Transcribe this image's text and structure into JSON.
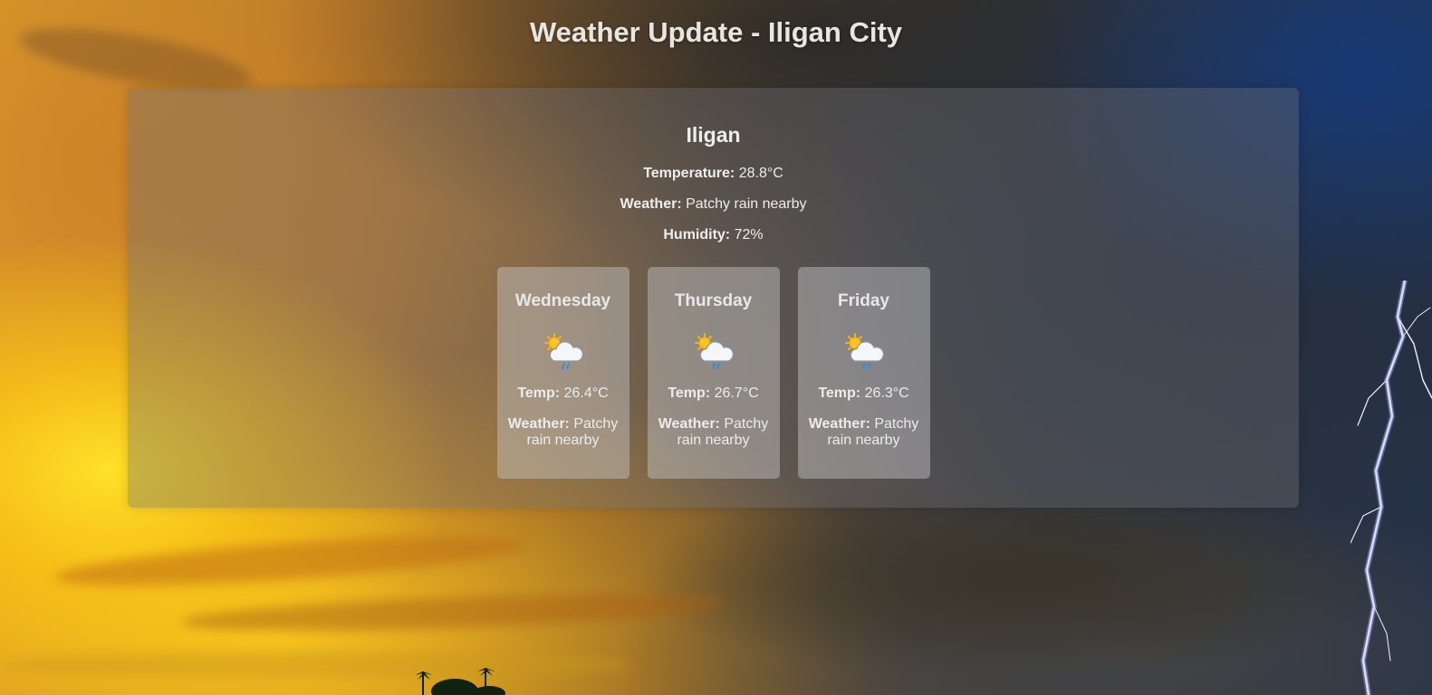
{
  "header": {
    "title": "Weather Update - Iligan City"
  },
  "current": {
    "city": "Iligan",
    "temperature_label": "Temperature:",
    "temperature_value": "28.8°C",
    "weather_label": "Weather:",
    "weather_value": "Patchy rain nearby",
    "humidity_label": "Humidity:",
    "humidity_value": "72%"
  },
  "forecast": [
    {
      "day": "Wednesday",
      "icon": "patchy-rain-icon",
      "temp_label": "Temp:",
      "temp_value": "26.4°C",
      "weather_label": "Weather:",
      "weather_value": "Patchy rain nearby"
    },
    {
      "day": "Thursday",
      "icon": "patchy-rain-icon",
      "temp_label": "Temp:",
      "temp_value": "26.7°C",
      "weather_label": "Weather:",
      "weather_value": "Patchy rain nearby"
    },
    {
      "day": "Friday",
      "icon": "patchy-rain-icon",
      "temp_label": "Temp:",
      "temp_value": "26.3°C",
      "weather_label": "Weather:",
      "weather_value": "Patchy rain nearby"
    }
  ],
  "colors": {
    "text": "#ececec",
    "panel": "rgba(110,110,115,0.38)",
    "card": "rgba(200,200,200,0.45)",
    "sun": "#f7b500",
    "rain": "#2f8fe0"
  }
}
